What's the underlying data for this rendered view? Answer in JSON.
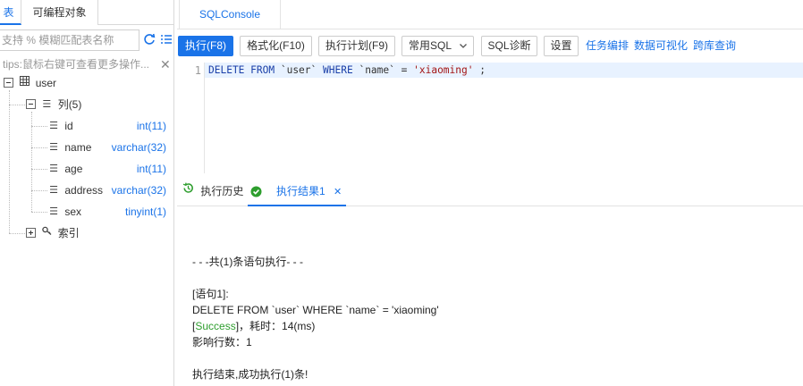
{
  "left": {
    "tabs": [
      "表",
      "可编程对象"
    ],
    "search_placeholder": "支持 % 模糊匹配表名称",
    "tips": "tips:鼠标右键可查看更多操作...",
    "tree": {
      "table": "user",
      "columns_label": "列(5)",
      "columns": [
        {
          "name": "id",
          "type": "int(11)"
        },
        {
          "name": "name",
          "type": "varchar(32)"
        },
        {
          "name": "age",
          "type": "int(11)"
        },
        {
          "name": "address",
          "type": "varchar(32)"
        },
        {
          "name": "sex",
          "type": "tinyint(1)"
        }
      ],
      "index_label": "索引"
    }
  },
  "right": {
    "tab": "SQLConsole",
    "toolbar": {
      "execute": "执行(F8)",
      "format": "格式化(F10)",
      "plan": "执行计划(F9)",
      "common_sql": "常用SQL",
      "diagnose": "SQL诊断",
      "settings": "设置",
      "links": [
        "任务编排",
        "数据可视化",
        "跨库查询"
      ]
    },
    "editor": {
      "line_number": "1",
      "tokens": {
        "kw1": "DELETE FROM",
        "tbl": "`user`",
        "kw2": "WHERE",
        "col": "`name`",
        "op": "=",
        "val": "'xiaoming'",
        "end": ";"
      }
    },
    "result_tabs": {
      "history": "执行历史",
      "result": "执行结果1"
    },
    "result": {
      "line1": "- - -共(1)条语句执行- - -",
      "line2": "[语句1]:",
      "line3": "DELETE FROM `user` WHERE `name` = 'xiaoming'",
      "success_open": "[",
      "success": "Success",
      "success_close": "]",
      "timing": "，耗时：14(ms)",
      "affected": "影响行数：1",
      "done": "执行结束,成功执行(1)条!"
    }
  }
}
